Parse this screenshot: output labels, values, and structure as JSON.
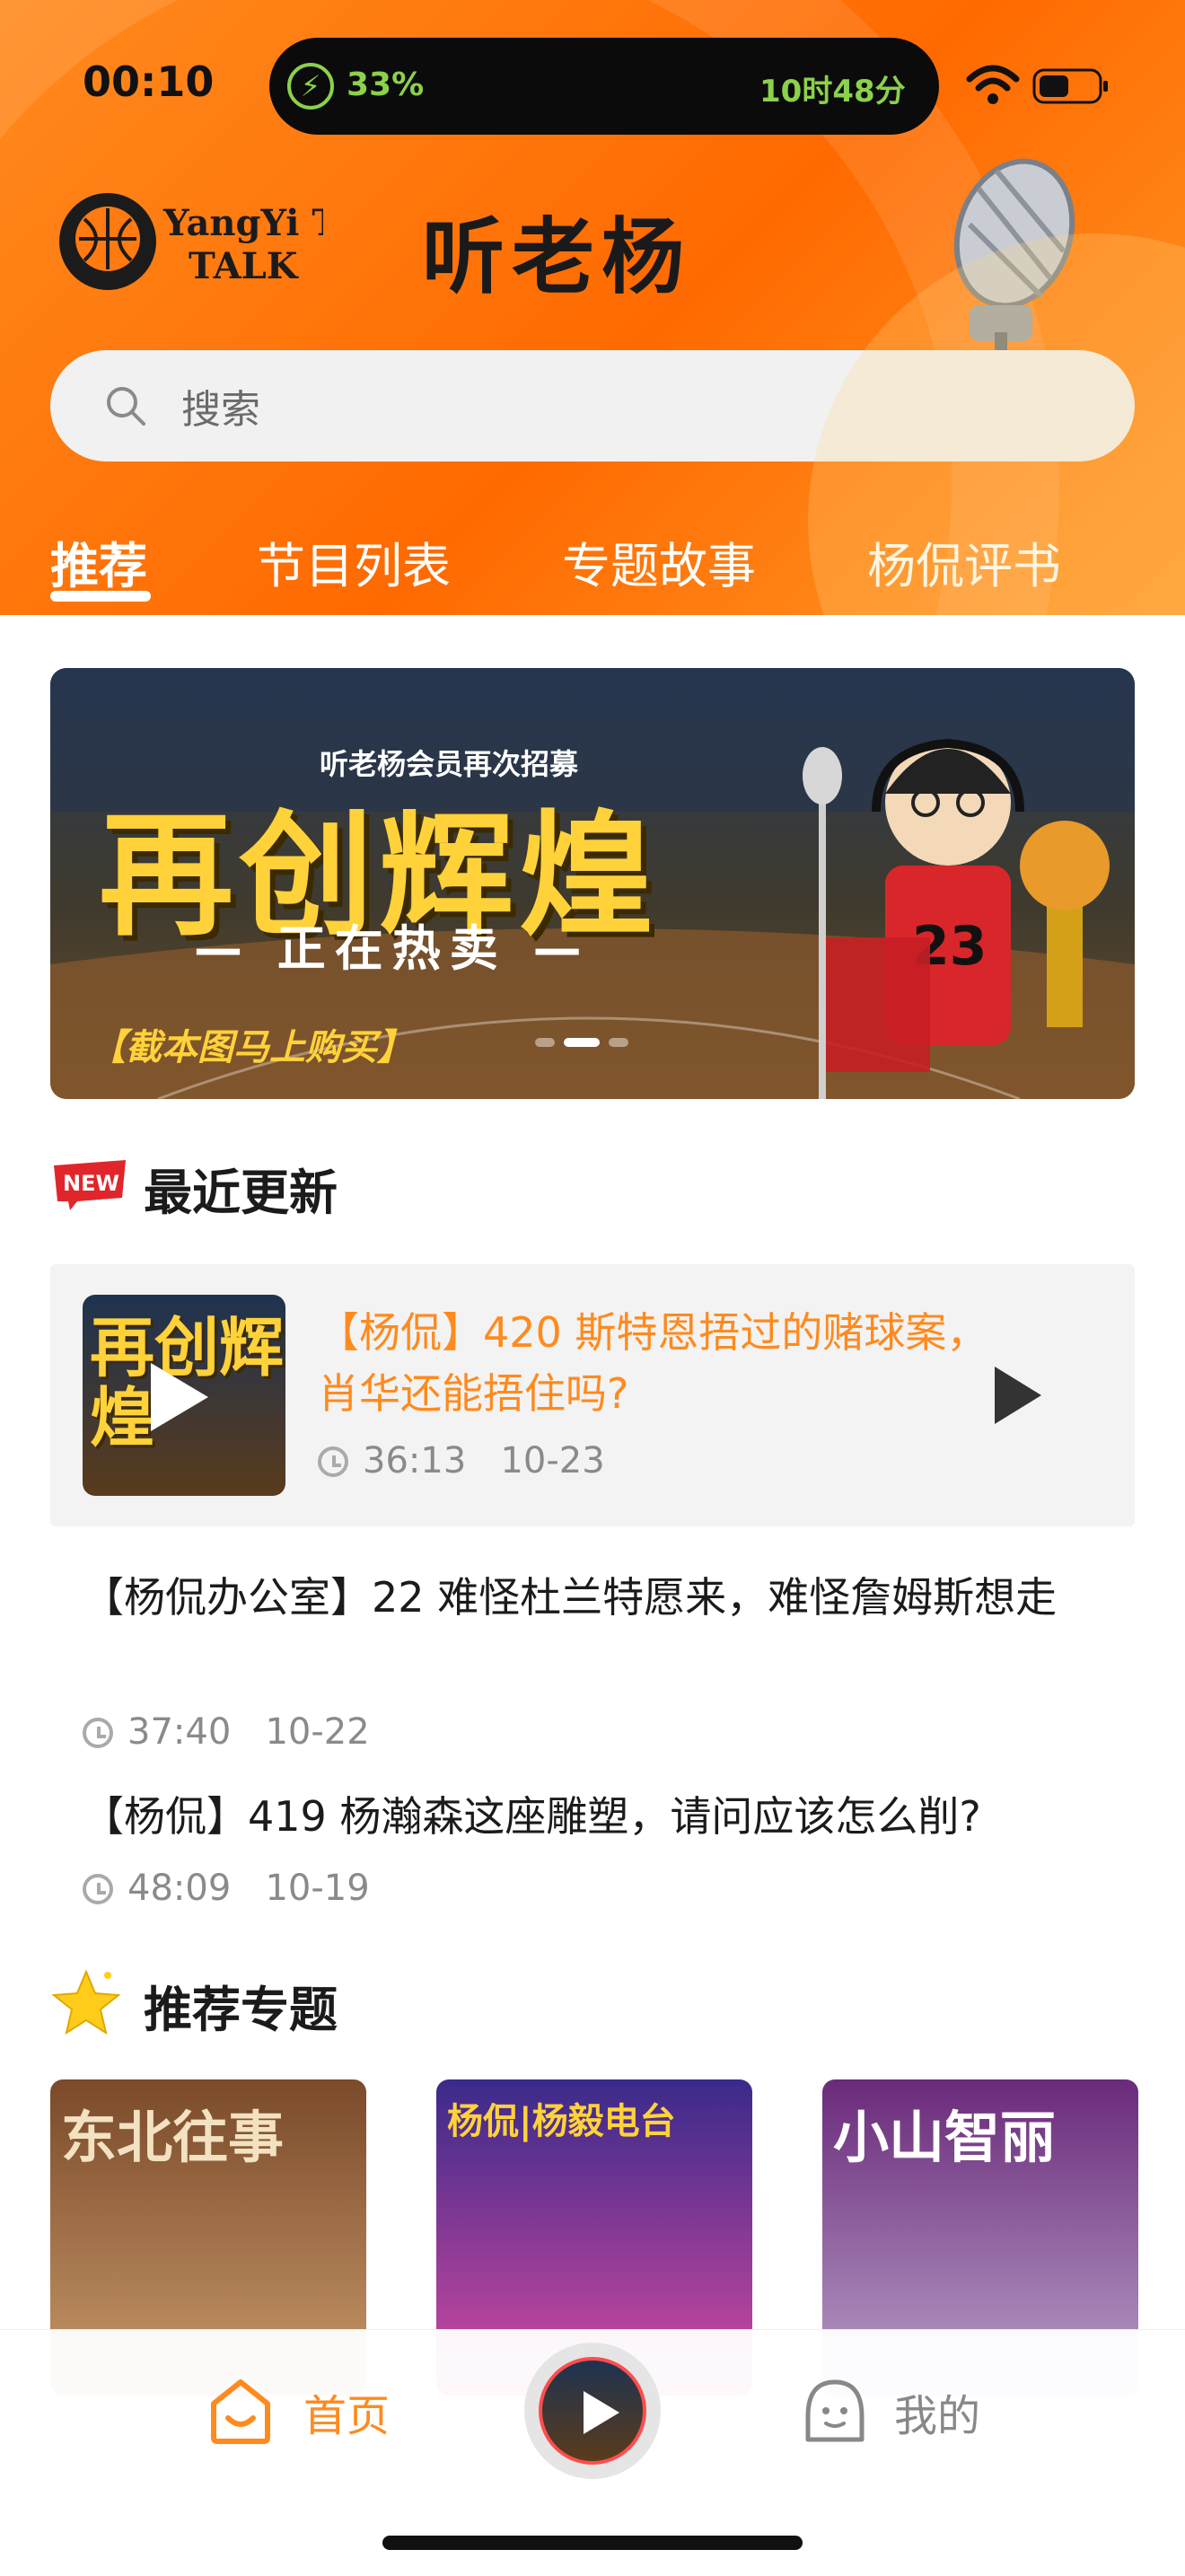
{
  "status_bar": {
    "time": "00:10",
    "battery_percent": "33%",
    "remaining": "10时48分"
  },
  "header": {
    "brand_logo_text": "YangYi TALK",
    "title": "听老杨"
  },
  "search": {
    "placeholder": "搜索"
  },
  "tabs": [
    {
      "label": "推荐",
      "active": true
    },
    {
      "label": "节目列表",
      "active": false
    },
    {
      "label": "专题故事",
      "active": false
    },
    {
      "label": "杨侃评书",
      "active": false
    }
  ],
  "banner": {
    "kicker": "听老杨会员再次招募",
    "title": "再创辉煌",
    "subtitle": "— 正在热卖 —",
    "cta": "【截本图马上购买】",
    "jersey_number": "23",
    "slide_count": 3,
    "active_slide": 2
  },
  "recent": {
    "badge": "NEW",
    "title": "最近更新",
    "featured": {
      "thumb_text": "再创辉煌",
      "title": "【杨侃】420 斯特恩捂过的赌球案，肖华还能捂住吗?",
      "duration": "36:13",
      "date": "10-23"
    },
    "items": [
      {
        "title": "【杨侃办公室】22 难怪杜兰特愿来，难怪詹姆斯想走",
        "duration": "37:40",
        "date": "10-22"
      },
      {
        "title": "【杨侃】419 杨瀚森这座雕塑，请问应该怎么削?",
        "duration": "48:09",
        "date": "10-19"
      }
    ]
  },
  "topics": {
    "title": "推荐专题",
    "cards": [
      {
        "text": "东北往事",
        "color_top": "#7a4a2a",
        "color_bottom": "#c89a6a",
        "text_color": "#f3e2c2"
      },
      {
        "text": "杨侃|杨毅电台",
        "color_top": "#3a2a8a",
        "color_bottom": "#d64aa0",
        "text_color": "#ffd23a"
      },
      {
        "text": "小山智丽",
        "color_top": "#6a2a7a",
        "color_bottom": "#b8a0c8",
        "text_color": "#ffffff"
      }
    ]
  },
  "tabbar": {
    "home_label": "首页",
    "me_label": "我的"
  },
  "colors": {
    "accent": "#ff8a1e",
    "header_bg": "#ff7a10"
  }
}
